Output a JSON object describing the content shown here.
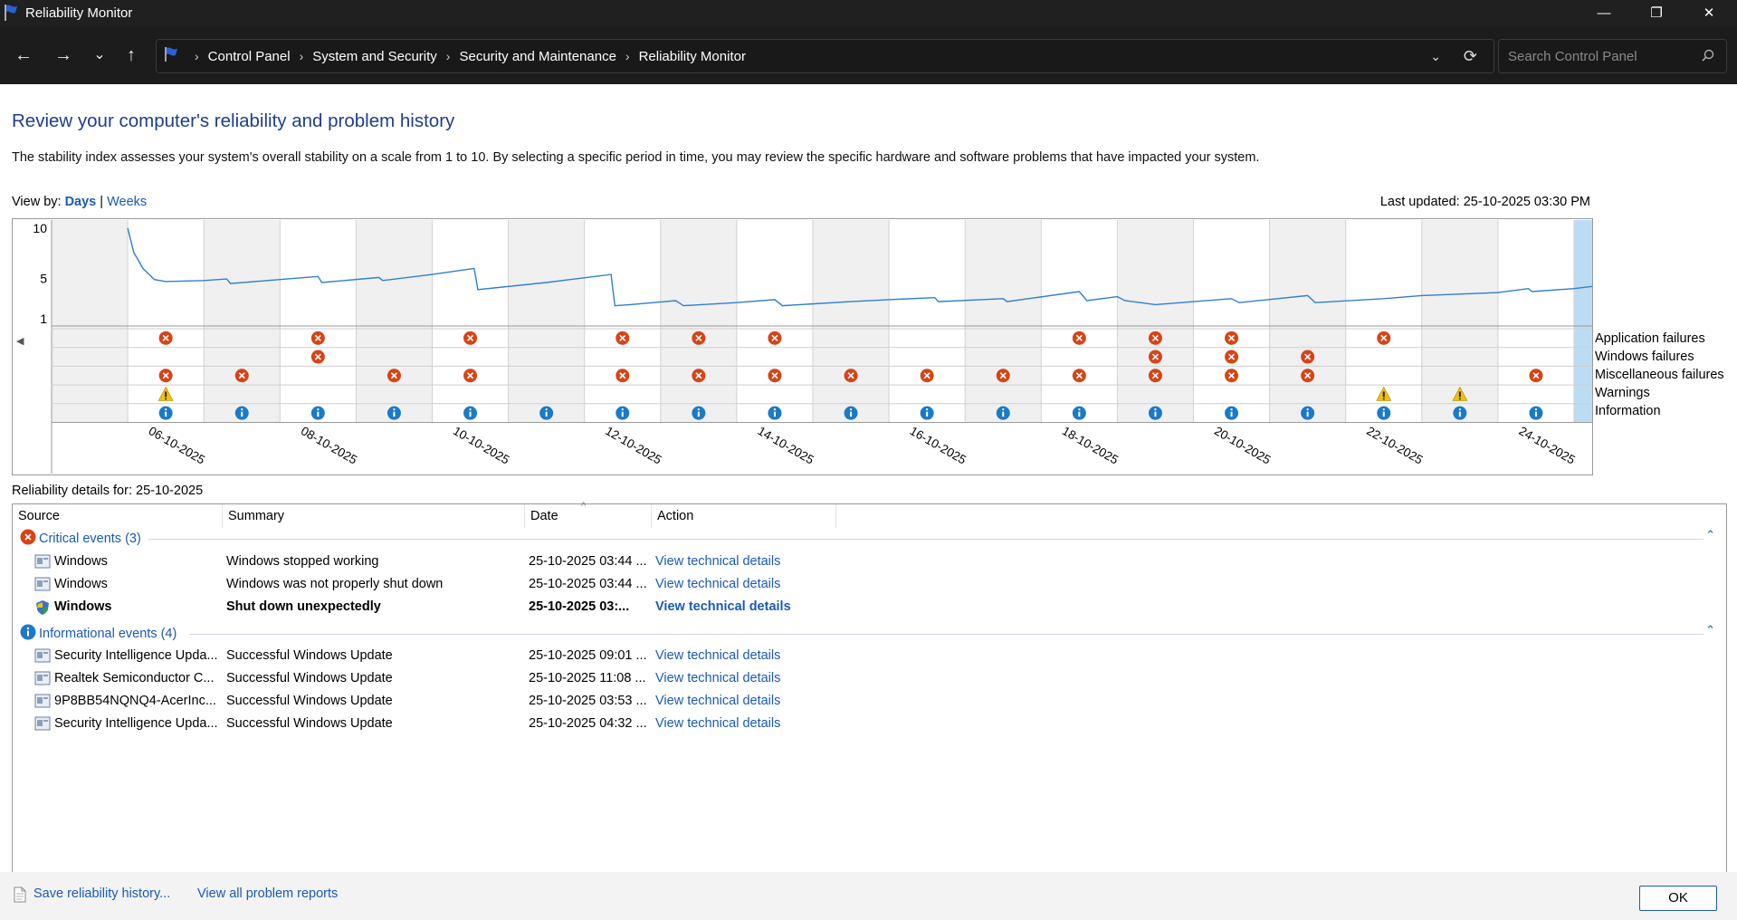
{
  "window": {
    "title": "Reliability Monitor",
    "minimize": "—",
    "restore": "❐",
    "close": "✕"
  },
  "nav": {
    "back": "←",
    "forward": "→",
    "recent": "⌄",
    "up": "↑",
    "breadcrumbs": [
      "Control Panel",
      "System and Security",
      "Security and Maintenance",
      "Reliability Monitor"
    ],
    "search_placeholder": "Search Control Panel"
  },
  "heading": "Review your computer's reliability and problem history",
  "description": "The stability index assesses your system's overall stability on a scale from 1 to 10. By selecting a specific period in time, you may review the specific hardware and software problems that have impacted your system.",
  "view_by": {
    "label": "View by:",
    "days": "Days",
    "separator": "|",
    "weeks": "Weeks"
  },
  "last_updated": "Last updated: 25-10-2025 03:30 PM",
  "chart_data": {
    "type": "line",
    "y_ticks": [
      "10",
      "5",
      "1"
    ],
    "ylim": [
      1,
      10
    ],
    "x": [
      "05-10-2025",
      "06-10-2025",
      "07-10-2025",
      "08-10-2025",
      "09-10-2025",
      "10-10-2025",
      "11-10-2025",
      "12-10-2025",
      "13-10-2025",
      "14-10-2025",
      "15-10-2025",
      "16-10-2025",
      "17-10-2025",
      "18-10-2025",
      "19-10-2025",
      "20-10-2025",
      "21-10-2025",
      "22-10-2025",
      "23-10-2025",
      "24-10-2025",
      "25-10-2025"
    ],
    "x_tick_labels": [
      "06-10-2025",
      "08-10-2025",
      "10-10-2025",
      "12-10-2025",
      "14-10-2025",
      "16-10-2025",
      "18-10-2025",
      "20-10-2025",
      "22-10-2025",
      "24-10-2025"
    ],
    "selected_date": "25-10-2025",
    "stability_index": [
      [
        1.0,
        10.0
      ],
      [
        1.08,
        7.6
      ],
      [
        1.2,
        6.0
      ],
      [
        1.35,
        4.9
      ],
      [
        1.5,
        4.7
      ],
      [
        2.0,
        4.8
      ],
      [
        2.3,
        4.95
      ],
      [
        2.35,
        4.5
      ],
      [
        3.0,
        4.9
      ],
      [
        3.5,
        5.2
      ],
      [
        3.55,
        4.6
      ],
      [
        4.3,
        5.1
      ],
      [
        4.35,
        4.8
      ],
      [
        5.0,
        5.4
      ],
      [
        5.55,
        6.0
      ],
      [
        5.6,
        3.9
      ],
      [
        6.5,
        4.6
      ],
      [
        7.35,
        5.4
      ],
      [
        7.4,
        2.3
      ],
      [
        7.6,
        2.4
      ],
      [
        8.2,
        2.8
      ],
      [
        8.3,
        2.3
      ],
      [
        9.0,
        2.6
      ],
      [
        9.5,
        2.9
      ],
      [
        9.6,
        2.3
      ],
      [
        10.5,
        2.7
      ],
      [
        11.0,
        2.9
      ],
      [
        11.6,
        3.1
      ],
      [
        11.65,
        2.7
      ],
      [
        12.5,
        3.0
      ],
      [
        12.55,
        2.7
      ],
      [
        13.5,
        3.7
      ],
      [
        13.6,
        2.8
      ],
      [
        14.0,
        3.2
      ],
      [
        14.1,
        2.8
      ],
      [
        14.3,
        2.6
      ],
      [
        14.5,
        2.4
      ],
      [
        15.5,
        3.0
      ],
      [
        15.6,
        2.6
      ],
      [
        16.5,
        3.3
      ],
      [
        16.6,
        2.6
      ],
      [
        17.5,
        3.0
      ],
      [
        18.0,
        3.3
      ],
      [
        19.0,
        3.6
      ],
      [
        19.4,
        4.0
      ],
      [
        19.45,
        3.7
      ],
      [
        20.0,
        4.0
      ],
      [
        20.55,
        4.5
      ],
      [
        20.65,
        3.0
      ]
    ],
    "series": [
      {
        "name": "Application failures",
        "icon": "error",
        "dates": [
          1,
          3,
          5,
          7,
          8,
          9,
          13,
          14,
          15,
          17
        ]
      },
      {
        "name": "Windows failures",
        "icon": "error",
        "dates": [
          3,
          14,
          15,
          16,
          20
        ]
      },
      {
        "name": "Miscellaneous failures",
        "icon": "error",
        "dates": [
          1,
          2,
          4,
          5,
          7,
          8,
          9,
          10,
          11,
          12,
          13,
          14,
          15,
          16,
          19,
          20
        ]
      },
      {
        "name": "Warnings",
        "icon": "warning",
        "dates": [
          1,
          17,
          18
        ]
      },
      {
        "name": "Information",
        "icon": "info",
        "dates": [
          1,
          2,
          3,
          4,
          5,
          6,
          7,
          8,
          9,
          10,
          11,
          12,
          13,
          14,
          15,
          16,
          17,
          18,
          19,
          20
        ]
      }
    ],
    "colors": {
      "line": "#2f7fd1",
      "selected": "#bcdcf4",
      "shaded": "#f0f0f0",
      "error": "#d84315",
      "warning": "#f2c100",
      "info": "#1a7ac8"
    }
  },
  "details_for": "Reliability details for: 25-10-2025",
  "columns": [
    "Source",
    "Summary",
    "Date",
    "Action"
  ],
  "sort_indicator": "^",
  "groups": [
    {
      "title": "Critical events (3)",
      "icon": "error-icon",
      "collapse": "⌃",
      "rows": [
        {
          "source": "Windows",
          "summary": "Windows stopped working",
          "date": "25-10-2025 03:44 ...",
          "action": "View technical details",
          "bold": false,
          "icon": "window"
        },
        {
          "source": "Windows",
          "summary": "Windows was not properly shut down",
          "date": "25-10-2025 03:44 ...",
          "action": "View technical details",
          "bold": false,
          "icon": "window"
        },
        {
          "source": "Windows",
          "summary": "Shut down unexpectedly",
          "date": "25-10-2025 03:...",
          "action": "View technical details",
          "bold": true,
          "icon": "shield"
        }
      ]
    },
    {
      "title": "Informational events (4)",
      "icon": "info-icon",
      "collapse": "⌃",
      "rows": [
        {
          "source": "Security Intelligence Upda...",
          "summary": "Successful Windows Update",
          "date": "25-10-2025 09:01 ...",
          "action": "View technical details",
          "bold": false,
          "icon": "window"
        },
        {
          "source": "Realtek Semiconductor C...",
          "summary": "Successful Windows Update",
          "date": "25-10-2025 11:08 ...",
          "action": "View technical details",
          "bold": false,
          "icon": "window"
        },
        {
          "source": "9P8BB54NQNQ4-AcerInc...",
          "summary": "Successful Windows Update",
          "date": "25-10-2025 03:53 ...",
          "action": "View technical details",
          "bold": false,
          "icon": "window"
        },
        {
          "source": "Security Intelligence Upda...",
          "summary": "Successful Windows Update",
          "date": "25-10-2025 04:32 ...",
          "action": "View technical details",
          "bold": false,
          "icon": "window"
        }
      ]
    }
  ],
  "footer": {
    "save": "Save reliability history...",
    "view_all": "View all problem reports",
    "ok": "OK"
  }
}
